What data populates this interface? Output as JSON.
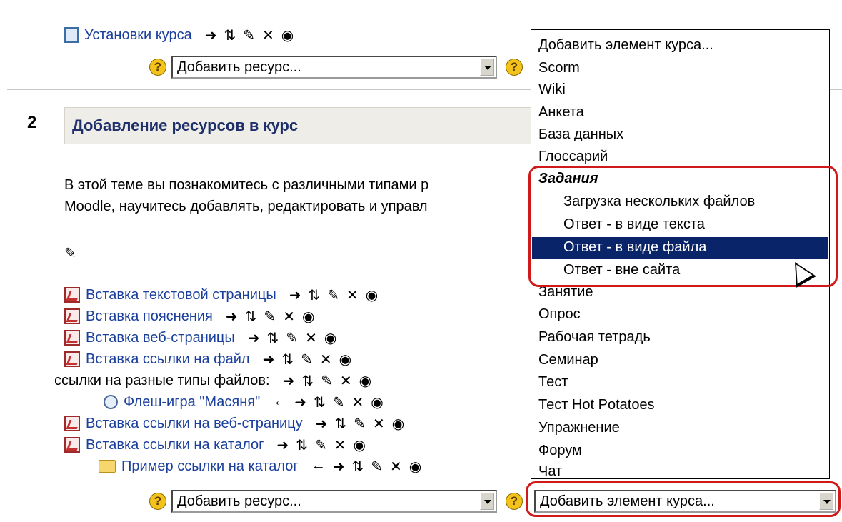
{
  "top": {
    "course_settings_link": "Установки курса",
    "add_resource_placeholder": "Добавить ресурс..."
  },
  "section": {
    "number": "2",
    "title": "Добавление ресурсов в курс",
    "desc_line1": "В этой теме вы познакомитесь с различными типами р",
    "desc_line2": "Moodle, научитесь добавлять, редактировать и управл"
  },
  "resources": [
    {
      "label": "Вставка текстовой страницы",
      "icon": "pdf-file-icon"
    },
    {
      "label": "Вставка пояснения",
      "icon": "pdf-file-icon"
    },
    {
      "label": "Вставка веб-страницы",
      "icon": "pdf-file-icon"
    },
    {
      "label": "Вставка ссылки на файл",
      "icon": "pdf-file-icon"
    },
    {
      "label": "ссылки на разные типы файлов:",
      "icon": "none"
    },
    {
      "label": "Флеш-игра \"Масяня\"",
      "icon": "flash-file-icon"
    },
    {
      "label": "Вставка ссылки на веб-страницу",
      "icon": "pdf-file-icon"
    },
    {
      "label": "Вставка ссылки на каталог",
      "icon": "pdf-file-icon"
    },
    {
      "label": "Пример ссылки на каталог",
      "icon": "folder-icon"
    }
  ],
  "bottom": {
    "add_resource_placeholder": "Добавить ресурс...",
    "add_activity_value": "Добавить элемент курса..."
  },
  "dropdown": {
    "options": [
      "Добавить элемент курса...",
      "Scorm",
      "Wiki",
      "Анкета",
      "База данных",
      "Глоссарий"
    ],
    "group_label": "Задания",
    "group_options": [
      "Загрузка нескольких файлов",
      "Ответ - в виде текста",
      "Ответ - в виде файла",
      "Ответ - вне сайта"
    ],
    "options_after": [
      "Занятие",
      "Опрос",
      "Рабочая тетрадь",
      "Семинар",
      "Тест",
      "Тест Hot Potatoes",
      "Упражнение",
      "Форум",
      "Чат"
    ]
  },
  "colors": {
    "link": "#1a3f9c",
    "highlight": "#0a246a",
    "annotation": "#d01a1a"
  }
}
